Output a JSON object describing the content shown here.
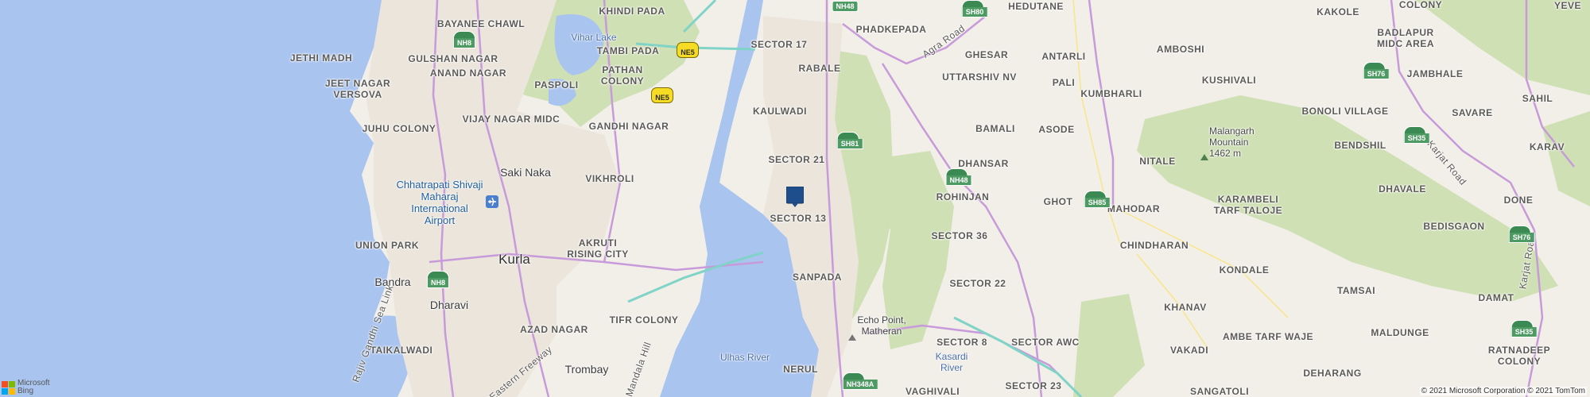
{
  "map": {
    "labels": {
      "jethi_madh": "JETHI MADH",
      "bayanee_chawl": "BAYANEE CHAWL",
      "khindi_pada": "KHINDI PADA",
      "vihar_lake": "Vihar Lake",
      "tambi_pada": "TAMBI PADA",
      "gulshan_nagar": "GULSHAN NAGAR",
      "jeet_nagar_versova": "JEET NAGAR\nVERSOVA",
      "anand_nagar": "ANAND NAGAR",
      "pathan_colony": "PATHAN\nCOLONY",
      "paspoli": "PASPOLI",
      "juhu_colony": "JUHU COLONY",
      "vijay_nagar_midc": "VIJAY NAGAR MIDC",
      "gandhi_nagar": "GANDHI NAGAR",
      "saki_naka": "Saki Naka",
      "vikhroli": "VIKHROLI",
      "airport": "Chhatrapati Shivaji\nMaharaj\nInternational\nAirport",
      "union_park": "UNION PARK",
      "kurla": "Kurla",
      "akruti_rising_city": "AKRUTI\nRISING CITY",
      "bandra": "Bandra",
      "dharavi": "Dharavi",
      "azad_nagar": "AZAD NAGAR",
      "tifr_colony": "TIFR COLONY",
      "taikalwadi": "TAIKALWADI",
      "trombay": "Trombay",
      "mandala_hill": "Mandala Hill",
      "eastern_freeway": "Eastern Freeway",
      "rajiv_gandhi_sea_link": "Rajiv Gandhi Sea Link",
      "sector_17": "SECTOR 17",
      "rabale": "RABALE",
      "kaulwadi": "KAULWADI",
      "sector_21": "SECTOR 21",
      "sector_13": "SECTOR 13",
      "sanpada": "SANPADA",
      "nerul": "NERUL",
      "ulhas_river": "Ulhas River",
      "echo_point": "Echo Point,\nMatheran",
      "phadkepada": "PHADKEPADA",
      "agra_road": "Agra Road",
      "hedutane": "HEDUTANE",
      "ghesar": "GHESAR",
      "antarli": "ANTARLI",
      "uttarshiv_nv": "UTTARSHIV NV",
      "pali": "PALI",
      "bamali": "BAMALI",
      "asode": "ASODE",
      "dhansar": "DHANSAR",
      "rohinjan": "ROHINJAN",
      "ghot": "GHOT",
      "sector_36": "SECTOR 36",
      "sector_22": "SECTOR 22",
      "sector_8": "SECTOR 8",
      "sector_awc": "SECTOR AWC",
      "sector_23": "SECTOR 23",
      "kasardi_river": "Kasardi\nRiver",
      "vaghivali": "VAGHIVALI",
      "kakole": "KAKOLE",
      "yeve": "YEVE",
      "colony": "COLONY",
      "badlapur_midc": "BADLAPUR\nMIDC AREA",
      "amboshi": "AMBOSHI",
      "kushivali": "KUSHIVALI",
      "jambhale": "JAMBHALE",
      "sahil": "SAHIL",
      "kumbharli": "KUMBHARLI",
      "bonoli_village": "BONOLI VILLAGE",
      "savare": "SAVARE",
      "malangarh": "Malangarh\nMountain\n1462 m",
      "bendshil": "BENDSHIL",
      "karav": "KARAV",
      "nitale": "NITALE",
      "karjat_road": "Karjat Road",
      "dhavale": "DHAVALE",
      "mahodar": "MAHODAR",
      "karambeli": "KARAMBELI\nTARF TALOJE",
      "done": "DONE",
      "bedisgaon": "BEDISGAON",
      "chindharan": "CHINDHARAN",
      "kondale": "KONDALE",
      "tamsai": "TAMSAI",
      "khanav": "KHANAV",
      "damat": "DAMAT",
      "ambe_tarf_waje": "AMBE TARF WAJE",
      "maldunge": "MALDUNGE",
      "vakadi": "VAKADI",
      "ratnadeep_colony": "RATNADEEP\nCOLONY",
      "deharang": "DEHARANG",
      "sangatoli": "SANGATOLI",
      "karjat_road2": "Karjat Road"
    },
    "shields": {
      "nh8_top": "NH8",
      "nh48_top": "NH48",
      "sh80": "SH80",
      "ne5_a": "NE5",
      "ne5_b": "NE5",
      "sh81": "SH81",
      "nh48_mid": "NH48",
      "sh85": "SH85",
      "sh76_a": "SH76",
      "sh35_a": "SH35",
      "sh76_b": "SH76",
      "sh35_b": "SH35",
      "nh8_bottom": "NH8",
      "nh348a": "NH348A"
    },
    "attribution": "© 2021 Microsoft Corporation © 2021 TomTom",
    "logo": {
      "line1": "Microsoft",
      "line2": "Bing"
    },
    "colors": {
      "water": "#a9c4ef",
      "land": "#f2efe9",
      "forest": "#cfe0b4",
      "urban": "#e9e4dc",
      "major_road": "#c79ad9",
      "highway": "#7fd3c7",
      "minor_road": "#f8e58a",
      "marker": "#1f4e8c"
    },
    "icons": [
      "marker-pin-icon",
      "airport-icon",
      "peak-icon",
      "microsoft-logo-icon"
    ]
  }
}
